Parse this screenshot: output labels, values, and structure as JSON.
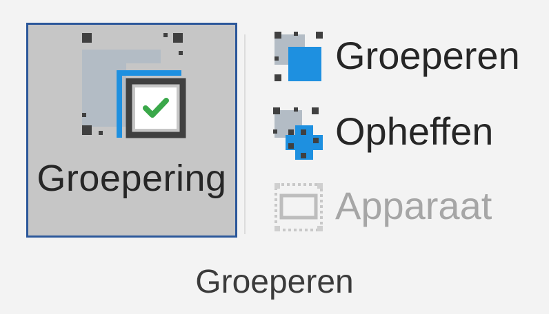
{
  "group": {
    "label": "Groeperen"
  },
  "large_button": {
    "label": "Groepering",
    "icon": "grouping-checkbox-icon",
    "selected": true
  },
  "small_buttons": [
    {
      "label": "Groeperen",
      "icon": "group-shapes-icon",
      "enabled": true
    },
    {
      "label": "Opheffen",
      "icon": "ungroup-shapes-icon",
      "enabled": true
    },
    {
      "label": "Apparaat",
      "icon": "device-frame-icon",
      "enabled": false
    }
  ],
  "colors": {
    "background": "#f3f3f3",
    "selected_fill": "#c6c6c6",
    "selected_border": "#2b579a",
    "accent_blue": "#1e90e0",
    "check_green": "#3aa84a",
    "disabled_text": "#a6a6a6"
  }
}
